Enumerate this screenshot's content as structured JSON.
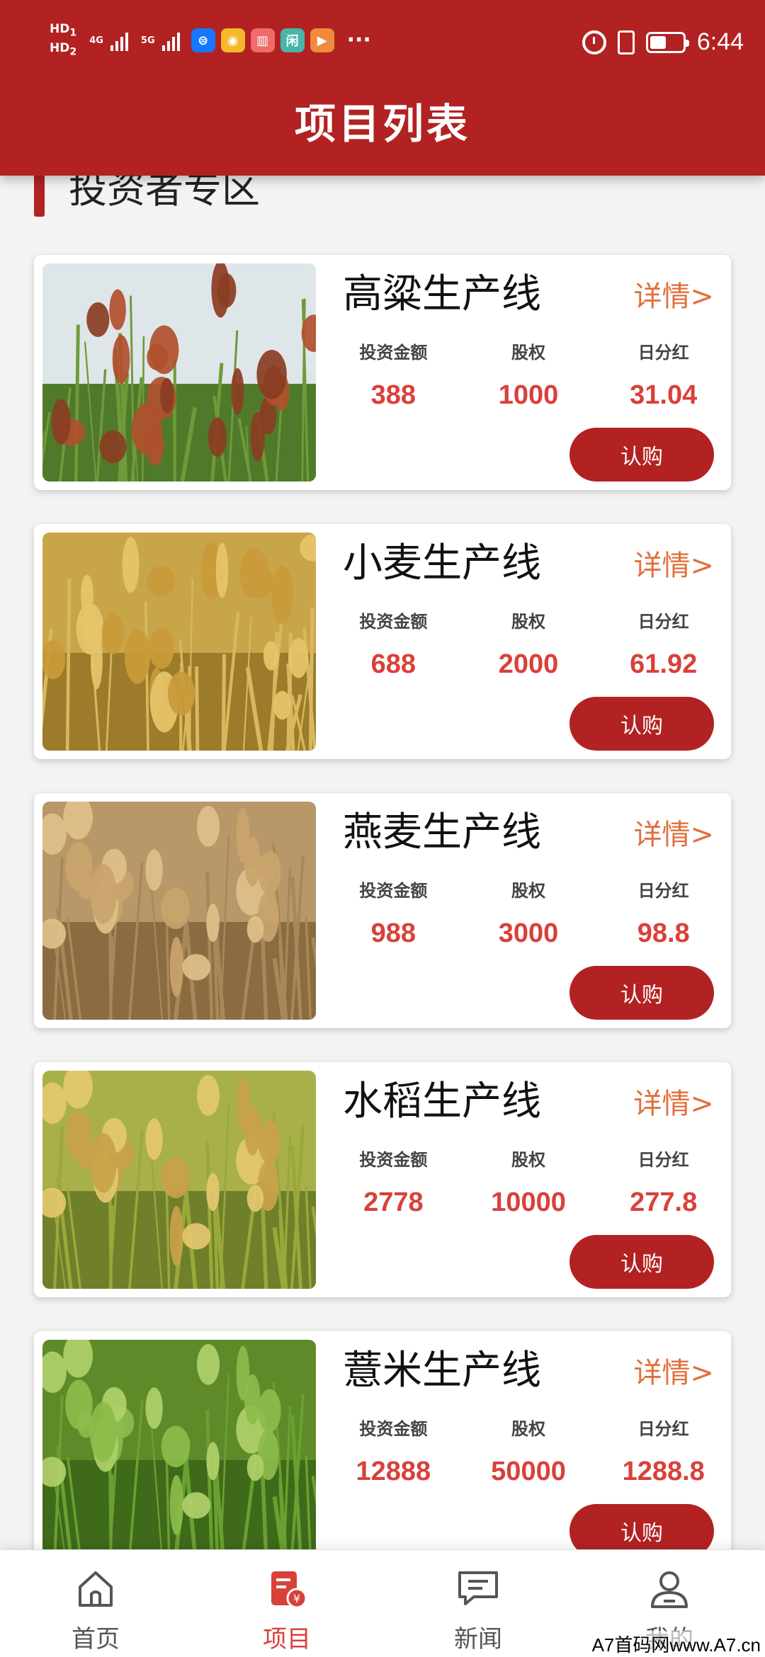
{
  "status_bar": {
    "hd1": "HD",
    "hd1_sub": "1",
    "hd2": "HD",
    "hd2_sub": "2",
    "net1": "4G",
    "net2": "5G",
    "time": "6:44",
    "overflow": "···",
    "app_icons": [
      {
        "icon": "alipay-icon",
        "glyph": "⊜",
        "color": "#1677ff"
      },
      {
        "icon": "weibo-icon",
        "glyph": "◉",
        "color": "#f5b72b"
      },
      {
        "icon": "book-icon",
        "glyph": "▥",
        "color": "#f06b6b"
      },
      {
        "icon": "xianyu-icon",
        "glyph": "闲",
        "color": "#46b6a8"
      },
      {
        "icon": "video-icon",
        "glyph": "▶",
        "color": "#f08a3c"
      }
    ]
  },
  "header": {
    "title": "项目列表"
  },
  "section": {
    "title": "投资者专区"
  },
  "cards": [
    {
      "title": "高粱生产线",
      "detail": "详情>",
      "amount_label": "投资金额",
      "amount": "388",
      "equity_label": "股权",
      "equity": "1000",
      "dividend_label": "日分红",
      "dividend": "31.04",
      "buy": "认购",
      "image": "sorghum"
    },
    {
      "title": "小麦生产线",
      "detail": "详情>",
      "amount_label": "投资金额",
      "amount": "688",
      "equity_label": "股权",
      "equity": "2000",
      "dividend_label": "日分红",
      "dividend": "61.92",
      "buy": "认购",
      "image": "wheat"
    },
    {
      "title": "燕麦生产线",
      "detail": "详情>",
      "amount_label": "投资金额",
      "amount": "988",
      "equity_label": "股权",
      "equity": "3000",
      "dividend_label": "日分红",
      "dividend": "98.8",
      "buy": "认购",
      "image": "oats"
    },
    {
      "title": "水稻生产线",
      "detail": "详情>",
      "amount_label": "投资金额",
      "amount": "2778",
      "equity_label": "股权",
      "equity": "10000",
      "dividend_label": "日分红",
      "dividend": "277.8",
      "buy": "认购",
      "image": "rice"
    },
    {
      "title": "薏米生产线",
      "detail": "详情>",
      "amount_label": "投资金额",
      "amount": "12888",
      "equity_label": "股权",
      "equity": "50000",
      "dividend_label": "日分红",
      "dividend": "1288.8",
      "buy": "认购",
      "image": "coix"
    }
  ],
  "tabbar": [
    {
      "label": "首页",
      "icon": "home-icon",
      "active": false
    },
    {
      "label": "项目",
      "icon": "project-icon",
      "active": true
    },
    {
      "label": "新闻",
      "icon": "news-icon",
      "active": false
    },
    {
      "label": "我的",
      "icon": "profile-icon",
      "active": false
    }
  ],
  "watermark": "A7首码网www.A7.cn",
  "colors": {
    "brand": "#b22222",
    "value": "#d8413a",
    "detail": "#e0703c"
  }
}
